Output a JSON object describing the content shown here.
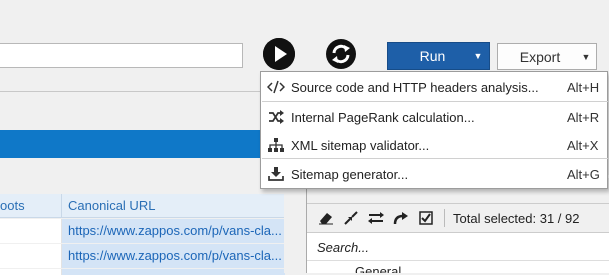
{
  "toolbar": {
    "run_label": "Run",
    "export_label": "Export"
  },
  "run_menu": {
    "items": [
      {
        "label": "Source code and HTTP headers analysis...",
        "shortcut": "Alt+H",
        "icon": "code-icon"
      },
      {
        "label": "Internal PageRank calculation...",
        "shortcut": "Alt+R",
        "icon": "shuffle-icon"
      },
      {
        "label": "XML sitemap validator...",
        "shortcut": "Alt+X",
        "icon": "sitemap-icon"
      },
      {
        "label": "Sitemap generator...",
        "shortcut": "Alt+G",
        "icon": "download-icon"
      }
    ]
  },
  "grid": {
    "columns": [
      "oots",
      "Canonical URL"
    ],
    "rows": [
      {
        "c1": "",
        "canonical": "https://www.zappos.com/p/vans-cla..."
      },
      {
        "c1": "",
        "canonical": "https://www.zappos.com/p/vans-cla..."
      }
    ]
  },
  "side_panel": {
    "total_selected": "Total selected: 31 / 92",
    "search_placeholder": "Search...",
    "tree_first": "General"
  },
  "colors": {
    "accent": "#1e5fa8",
    "header_blue": "#0f78c8",
    "link": "#1c66b8",
    "row_highlight": "#d4e4f6"
  }
}
